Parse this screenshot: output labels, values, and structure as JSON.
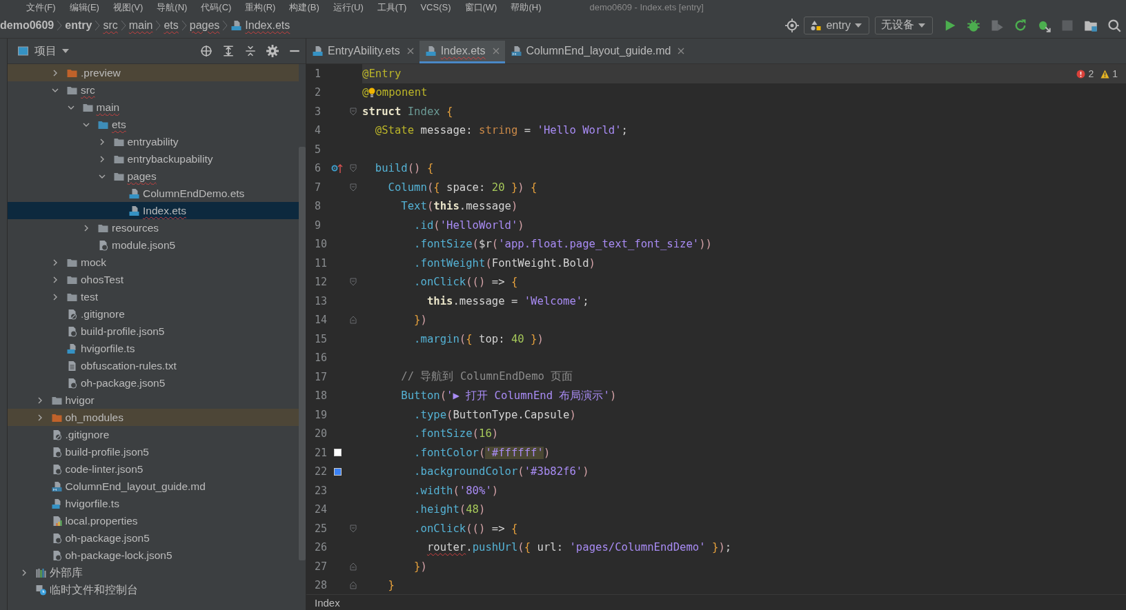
{
  "menu": [
    "文件(F)",
    "编辑(E)",
    "视图(V)",
    "导航(N)",
    "代码(C)",
    "重构(R)",
    "构建(B)",
    "运行(U)",
    "工具(T)",
    "VCS(S)",
    "窗口(W)",
    "帮助(H)"
  ],
  "window": {
    "title": "demo0609 - Index.ets [entry]"
  },
  "breadcrumbs": [
    {
      "label": "demo0609",
      "kind": "project",
      "problem": false
    },
    {
      "label": "entry",
      "kind": "module",
      "problem": false
    },
    {
      "label": "src",
      "kind": "folder",
      "problem": true
    },
    {
      "label": "main",
      "kind": "folder",
      "problem": true
    },
    {
      "label": "ets",
      "kind": "folder",
      "problem": true
    },
    {
      "label": "pages",
      "kind": "folder",
      "problem": true
    },
    {
      "label": "Index.ets",
      "kind": "file",
      "problem": true
    }
  ],
  "toolbar": {
    "run_config": "entry",
    "device": "无设备"
  },
  "project_panel": {
    "title": "项目"
  },
  "tree": [
    {
      "children": [
        {
          "children": [
            {
              "label": ".preview",
              "kind": "excluded-folder",
              "expanded": false,
              "selected": false,
              "excluded": true,
              "problem": false
            },
            {
              "label": "src",
              "kind": "folder",
              "expanded": true,
              "selected": false,
              "excluded": false,
              "problem": true,
              "children": [
                {
                  "label": "main",
                  "kind": "folder",
                  "expanded": true,
                  "selected": false,
                  "excluded": false,
                  "problem": true,
                  "children": [
                    {
                      "label": "ets",
                      "kind": "source-folder",
                      "expanded": true,
                      "selected": false,
                      "excluded": false,
                      "problem": true,
                      "children": [
                        {
                          "label": "entryability",
                          "kind": "folder",
                          "expanded": false,
                          "selected": false,
                          "excluded": false,
                          "problem": false
                        },
                        {
                          "label": "entrybackupability",
                          "kind": "folder",
                          "expanded": false,
                          "selected": false,
                          "excluded": false,
                          "problem": false
                        },
                        {
                          "label": "pages",
                          "kind": "folder",
                          "expanded": true,
                          "selected": false,
                          "excluded": false,
                          "problem": true,
                          "children": [
                            {
                              "label": "ColumnEndDemo.ets",
                              "kind": "ets",
                              "selected": false,
                              "excluded": false,
                              "problem": false
                            },
                            {
                              "label": "Index.ets",
                              "kind": "ets",
                              "selected": true,
                              "excluded": false,
                              "problem": true
                            }
                          ]
                        }
                      ]
                    },
                    {
                      "label": "resources",
                      "kind": "folder",
                      "expanded": false,
                      "selected": false,
                      "excluded": false,
                      "problem": false
                    },
                    {
                      "label": "module.json5",
                      "kind": "json",
                      "selected": false,
                      "excluded": false,
                      "problem": false
                    }
                  ]
                }
              ]
            },
            {
              "label": "mock",
              "kind": "folder",
              "expanded": false,
              "selected": false,
              "excluded": false,
              "problem": false
            },
            {
              "label": "ohosTest",
              "kind": "folder",
              "expanded": false,
              "selected": false,
              "excluded": false,
              "problem": false
            },
            {
              "label": "test",
              "kind": "folder",
              "expanded": false,
              "selected": false,
              "excluded": false,
              "problem": false
            },
            {
              "label": ".gitignore",
              "kind": "gitignore",
              "selected": false,
              "excluded": false,
              "problem": false
            },
            {
              "label": "build-profile.json5",
              "kind": "json",
              "selected": false,
              "excluded": false,
              "problem": false
            },
            {
              "label": "hvigorfile.ts",
              "kind": "ts",
              "selected": false,
              "excluded": false,
              "problem": false
            },
            {
              "label": "obfuscation-rules.txt",
              "kind": "text",
              "selected": false,
              "excluded": false,
              "problem": false
            },
            {
              "label": "oh-package.json5",
              "kind": "json",
              "selected": false,
              "excluded": false,
              "problem": false
            }
          ]
        },
        {
          "label": "hvigor",
          "kind": "folder",
          "expanded": false,
          "selected": false,
          "excluded": false,
          "problem": false
        },
        {
          "label": "oh_modules",
          "kind": "excluded-folder",
          "expanded": false,
          "selected": false,
          "excluded": true,
          "problem": false
        },
        {
          "label": ".gitignore",
          "kind": "gitignore",
          "selected": false,
          "excluded": false,
          "problem": false
        },
        {
          "label": "build-profile.json5",
          "kind": "json",
          "selected": false,
          "excluded": false,
          "problem": false
        },
        {
          "label": "code-linter.json5",
          "kind": "json",
          "selected": false,
          "excluded": false,
          "problem": false
        },
        {
          "label": "ColumnEnd_layout_guide.md",
          "kind": "md",
          "selected": false,
          "excluded": false,
          "problem": false
        },
        {
          "label": "hvigorfile.ts",
          "kind": "ts",
          "selected": false,
          "excluded": false,
          "problem": false
        },
        {
          "label": "local.properties",
          "kind": "properties",
          "selected": false,
          "excluded": false,
          "problem": false
        },
        {
          "label": "oh-package.json5",
          "kind": "json",
          "selected": false,
          "excluded": false,
          "problem": false
        },
        {
          "label": "oh-package-lock.json5",
          "kind": "json",
          "selected": false,
          "excluded": false,
          "problem": false
        }
      ]
    },
    {
      "label": "外部库",
      "kind": "library",
      "expanded": false,
      "selected": false,
      "excluded": false,
      "problem": false
    },
    {
      "label": "临时文件和控制台",
      "kind": "scratch",
      "selected": false,
      "excluded": false,
      "problem": false
    }
  ],
  "tabs": [
    {
      "label": "EntryAbility.ets",
      "kind": "ets",
      "selected": false,
      "problem": false
    },
    {
      "label": "Index.ets",
      "kind": "ets",
      "selected": true,
      "problem": true
    },
    {
      "label": "ColumnEnd_layout_guide.md",
      "kind": "md",
      "selected": false,
      "problem": false
    }
  ],
  "inspections": {
    "errors": "2",
    "warnings": "1"
  },
  "editor": {
    "lines": [
      {
        "number": "1",
        "current": true,
        "tokens": [
          {
            "text": "@Entry",
            "kind": "dec"
          }
        ]
      },
      {
        "number": "2",
        "current": false,
        "bulb": true,
        "tokens": [
          {
            "text": "@",
            "kind": "dec"
          },
          {
            "text": "omponent",
            "kind": "dec"
          }
        ]
      },
      {
        "number": "3",
        "current": false,
        "fold_open": true,
        "tokens": [
          {
            "text": "struct ",
            "kind": "kw"
          },
          {
            "text": "Index ",
            "kind": "type"
          },
          {
            "text": "{",
            "kind": "brace"
          }
        ]
      },
      {
        "number": "4",
        "current": false,
        "tokens": [
          {
            "text": "  @State",
            "kind": "dec"
          },
          {
            "text": " message: ",
            "kind": "plain"
          },
          {
            "text": "string",
            "kind": "tstr"
          },
          {
            "text": " = ",
            "kind": "plain"
          },
          {
            "text": "'Hello World'",
            "kind": "str"
          },
          {
            "text": ";",
            "kind": "plain"
          }
        ]
      },
      {
        "number": "5",
        "current": false
      },
      {
        "number": "6",
        "current": false,
        "overrides": true,
        "fold_open": true,
        "tokens": [
          {
            "text": "  build",
            "kind": "fn"
          },
          {
            "text": "()",
            "kind": "paren"
          },
          {
            "text": " {",
            "kind": "brace"
          }
        ]
      },
      {
        "number": "7",
        "current": false,
        "fold_open": true,
        "tokens": [
          {
            "text": "    Column",
            "kind": "fn"
          },
          {
            "text": "(",
            "kind": "paren"
          },
          {
            "text": "{",
            "kind": "brace"
          },
          {
            "text": " space: ",
            "kind": "plain"
          },
          {
            "text": "20",
            "kind": "num"
          },
          {
            "text": " }",
            "kind": "brace"
          },
          {
            "text": ")",
            "kind": "paren"
          },
          {
            "text": " {",
            "kind": "brace"
          }
        ]
      },
      {
        "number": "8",
        "current": false,
        "tokens": [
          {
            "text": "      Text",
            "kind": "fn"
          },
          {
            "text": "(",
            "kind": "paren"
          },
          {
            "text": "this",
            "kind": "kw"
          },
          {
            "text": ".message",
            "kind": "plain"
          },
          {
            "text": ")",
            "kind": "paren"
          }
        ]
      },
      {
        "number": "9",
        "current": false,
        "tokens": [
          {
            "text": "        .id",
            "kind": "fn"
          },
          {
            "text": "(",
            "kind": "paren"
          },
          {
            "text": "'HelloWorld'",
            "kind": "str"
          },
          {
            "text": ")",
            "kind": "paren"
          }
        ]
      },
      {
        "number": "10",
        "current": false,
        "tokens": [
          {
            "text": "        .fontSize",
            "kind": "fn"
          },
          {
            "text": "(",
            "kind": "paren"
          },
          {
            "text": "$r",
            "kind": "plain"
          },
          {
            "text": "(",
            "kind": "paren"
          },
          {
            "text": "'app.float.page_text_font_size'",
            "kind": "str"
          },
          {
            "text": "))",
            "kind": "paren"
          }
        ]
      },
      {
        "number": "11",
        "current": false,
        "tokens": [
          {
            "text": "        .fontWeight",
            "kind": "fn"
          },
          {
            "text": "(",
            "kind": "paren"
          },
          {
            "text": "FontWeight.Bold",
            "kind": "plain"
          },
          {
            "text": ")",
            "kind": "paren"
          }
        ]
      },
      {
        "number": "12",
        "current": false,
        "fold_open": true,
        "tokens": [
          {
            "text": "        .onClick",
            "kind": "fn"
          },
          {
            "text": "(()",
            "kind": "paren"
          },
          {
            "text": " => ",
            "kind": "plain"
          },
          {
            "text": "{",
            "kind": "brace"
          }
        ]
      },
      {
        "number": "13",
        "current": false,
        "tokens": [
          {
            "text": "          this",
            "kind": "kw"
          },
          {
            "text": ".message = ",
            "kind": "plain"
          },
          {
            "text": "'Welcome'",
            "kind": "str"
          },
          {
            "text": ";",
            "kind": "plain"
          }
        ]
      },
      {
        "number": "14",
        "current": false,
        "fold_close": true,
        "tokens": [
          {
            "text": "        }",
            "kind": "brace"
          },
          {
            "text": ")",
            "kind": "paren"
          }
        ]
      },
      {
        "number": "15",
        "current": false,
        "tokens": [
          {
            "text": "        .margin",
            "kind": "fn"
          },
          {
            "text": "(",
            "kind": "paren"
          },
          {
            "text": "{",
            "kind": "brace"
          },
          {
            "text": " top: ",
            "kind": "plain"
          },
          {
            "text": "40",
            "kind": "num"
          },
          {
            "text": " }",
            "kind": "brace"
          },
          {
            "text": ")",
            "kind": "paren"
          }
        ]
      },
      {
        "number": "16",
        "current": false
      },
      {
        "number": "17",
        "current": false,
        "tokens": [
          {
            "text": "      // 导航到 ColumnEndDemo 页面",
            "kind": "comment"
          }
        ]
      },
      {
        "number": "18",
        "current": false,
        "tokens": [
          {
            "text": "      Button",
            "kind": "fn"
          },
          {
            "text": "(",
            "kind": "paren"
          },
          {
            "text": "'▶ 打开 ColumnEnd 布局演示'",
            "kind": "str"
          },
          {
            "text": ")",
            "kind": "paren"
          }
        ]
      },
      {
        "number": "19",
        "current": false,
        "tokens": [
          {
            "text": "        .type",
            "kind": "fn"
          },
          {
            "text": "(",
            "kind": "paren"
          },
          {
            "text": "ButtonType.Capsule",
            "kind": "plain"
          },
          {
            "text": ")",
            "kind": "paren"
          }
        ]
      },
      {
        "number": "20",
        "current": false,
        "tokens": [
          {
            "text": "        .fontSize",
            "kind": "fn"
          },
          {
            "text": "(",
            "kind": "paren"
          },
          {
            "text": "16",
            "kind": "num"
          },
          {
            "text": ")",
            "kind": "paren"
          }
        ]
      },
      {
        "number": "21",
        "current": false,
        "color": "#ffffff",
        "tokens": [
          {
            "text": "        .fontColor",
            "kind": "fn"
          },
          {
            "text": "(",
            "kind": "paren"
          },
          {
            "text": "'#ffffff'",
            "kind": "strhl"
          },
          {
            "text": ")",
            "kind": "paren"
          }
        ]
      },
      {
        "number": "22",
        "current": false,
        "color": "#3b82f6",
        "tokens": [
          {
            "text": "        .backgroundColor",
            "kind": "fn"
          },
          {
            "text": "(",
            "kind": "paren"
          },
          {
            "text": "'#3b82f6'",
            "kind": "str"
          },
          {
            "text": ")",
            "kind": "paren"
          }
        ]
      },
      {
        "number": "23",
        "current": false,
        "tokens": [
          {
            "text": "        .width",
            "kind": "fn"
          },
          {
            "text": "(",
            "kind": "paren"
          },
          {
            "text": "'80%'",
            "kind": "str"
          },
          {
            "text": ")",
            "kind": "paren"
          }
        ]
      },
      {
        "number": "24",
        "current": false,
        "tokens": [
          {
            "text": "        .height",
            "kind": "fn"
          },
          {
            "text": "(",
            "kind": "paren"
          },
          {
            "text": "48",
            "kind": "num"
          },
          {
            "text": ")",
            "kind": "paren"
          }
        ]
      },
      {
        "number": "25",
        "current": false,
        "fold_open": true,
        "tokens": [
          {
            "text": "        .onClick",
            "kind": "fn"
          },
          {
            "text": "(()",
            "kind": "paren"
          },
          {
            "text": " => ",
            "kind": "plain"
          },
          {
            "text": "{",
            "kind": "brace"
          }
        ]
      },
      {
        "number": "26",
        "current": false,
        "tokens": [
          {
            "text": "          router",
            "kind": "err"
          },
          {
            "text": ".",
            "kind": "plain"
          },
          {
            "text": "pushUrl",
            "kind": "fn"
          },
          {
            "text": "(",
            "kind": "paren"
          },
          {
            "text": "{",
            "kind": "brace"
          },
          {
            "text": " url: ",
            "kind": "plain"
          },
          {
            "text": "'pages/ColumnEndDemo'",
            "kind": "str"
          },
          {
            "text": " }",
            "kind": "brace"
          },
          {
            "text": ")",
            "kind": "paren"
          },
          {
            "text": ";",
            "kind": "plain"
          }
        ]
      },
      {
        "number": "27",
        "current": false,
        "fold_close": true,
        "tokens": [
          {
            "text": "        }",
            "kind": "brace"
          },
          {
            "text": ")",
            "kind": "paren"
          }
        ]
      },
      {
        "number": "28",
        "current": false,
        "fold_close": true,
        "tokens": [
          {
            "text": "    }",
            "kind": "brace"
          }
        ]
      }
    ]
  },
  "status": {
    "breadcrumb": "Index"
  }
}
